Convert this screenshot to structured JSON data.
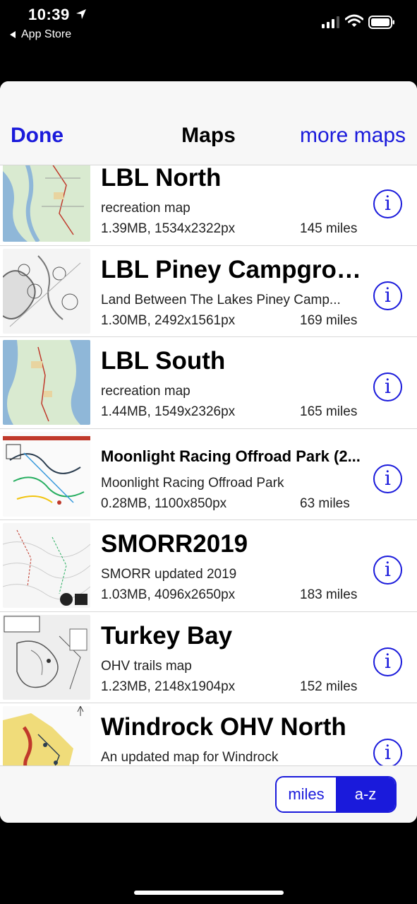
{
  "status_bar": {
    "time": "10:39",
    "back_label": "App Store"
  },
  "nav": {
    "done_label": "Done",
    "title": "Maps",
    "more_label": "more maps"
  },
  "maps": [
    {
      "title": "LBL North",
      "subtitle": "recreation map",
      "meta": "1.39MB, 1534x2322px",
      "distance": "145 miles",
      "thumb": "lake-map-thumbnail"
    },
    {
      "title": "LBL Piney Campground",
      "subtitle": "Land Between The Lakes Piney Camp...",
      "meta": "1.30MB, 2492x1561px",
      "distance": "169 miles",
      "thumb": "campground-map-thumbnail"
    },
    {
      "title": "LBL South",
      "subtitle": "recreation map",
      "meta": "1.44MB, 1549x2326px",
      "distance": "165 miles",
      "thumb": "lake-map-thumbnail"
    },
    {
      "title": "Moonlight Racing Offroad Park (2...",
      "subtitle": "Moonlight Racing Offroad Park",
      "meta": "0.28MB, 1100x850px",
      "distance": "63 miles",
      "thumb": "trail-map-thumbnail"
    },
    {
      "title": "SMORR2019",
      "subtitle": "SMORR updated 2019",
      "meta": "1.03MB, 4096x2650px",
      "distance": "183 miles",
      "thumb": "topo-map-thumbnail"
    },
    {
      "title": "Turkey Bay",
      "subtitle": "OHV trails map",
      "meta": "1.23MB, 2148x1904px",
      "distance": "152 miles",
      "thumb": "ohv-trail-map-thumbnail"
    },
    {
      "title": "Windrock OHV North",
      "subtitle": "An updated map for Windrock",
      "meta": "",
      "distance": "",
      "thumb": "windrock-map-thumbnail"
    }
  ],
  "info_glyph": "i",
  "sort": {
    "miles_label": "miles",
    "az_label": "a-z",
    "selected": "a-z"
  },
  "colors": {
    "accent": "#1a1adb"
  }
}
